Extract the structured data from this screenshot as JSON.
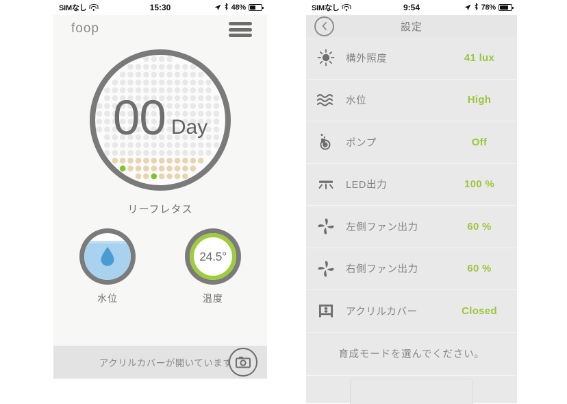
{
  "left_phone": {
    "status_bar": {
      "carrier": "SIMなし",
      "wifi_icon": "wifi-icon",
      "time": "15:30",
      "location_icon": "location-arrow-icon",
      "bluetooth_icon": "bluetooth-icon",
      "battery_percent": "48%",
      "battery_level": 48
    },
    "header": {
      "brand": "foop",
      "menu_icon": "hamburger-menu-icon"
    },
    "day_counter": {
      "value": "00",
      "unit": "Day",
      "ring_color": "#7a7a7a",
      "dot_colors": {
        "inactive": "#e8e8e8",
        "tan": "#e8d5b0",
        "green": "#7dc42a"
      }
    },
    "plant_name": "リーフレタス",
    "gauges": [
      {
        "name": "water-level",
        "icon": "water-drop-icon",
        "label": "水位",
        "value": "",
        "fill_color": "#a9d2ee",
        "ring_color": "#7b7b7b"
      },
      {
        "name": "temperature",
        "icon": "temperature-ring-icon",
        "label": "温度",
        "value": "24.5°",
        "fill_color": "#9fcc3b",
        "ring_color": "#7b7b7b"
      }
    ],
    "banner": {
      "message": "アクリルカバーが開いています。",
      "camera_icon": "camera-icon"
    }
  },
  "right_phone": {
    "status_bar": {
      "carrier": "SIMなし",
      "wifi_icon": "wifi-icon",
      "time": "9:54",
      "location_icon": "location-arrow-icon",
      "bluetooth_icon": "bluetooth-icon",
      "battery_percent": "78%",
      "battery_level": 78
    },
    "nav": {
      "back_icon": "chevron-left-circle-icon",
      "title": "設定"
    },
    "settings_rows": [
      {
        "icon": "sun-brightness-icon",
        "label": "構外照度",
        "value": "41 lux"
      },
      {
        "icon": "waves-water-level-icon",
        "label": "水位",
        "value": "High"
      },
      {
        "icon": "pump-icon",
        "label": "ポンプ",
        "value": "Off"
      },
      {
        "icon": "led-light-icon",
        "label": "LED出力",
        "value": "100 %"
      },
      {
        "icon": "fan-icon",
        "label": "左側ファン出力",
        "value": "60 %"
      },
      {
        "icon": "fan-icon",
        "label": "右側ファン出力",
        "value": "60 %"
      },
      {
        "icon": "acrylic-cover-icon",
        "label": "アクリルカバー",
        "value": "Closed"
      }
    ],
    "prompt": "育成モードを選んでください。",
    "value_color": "#9ac63c",
    "label_color": "#858585"
  }
}
